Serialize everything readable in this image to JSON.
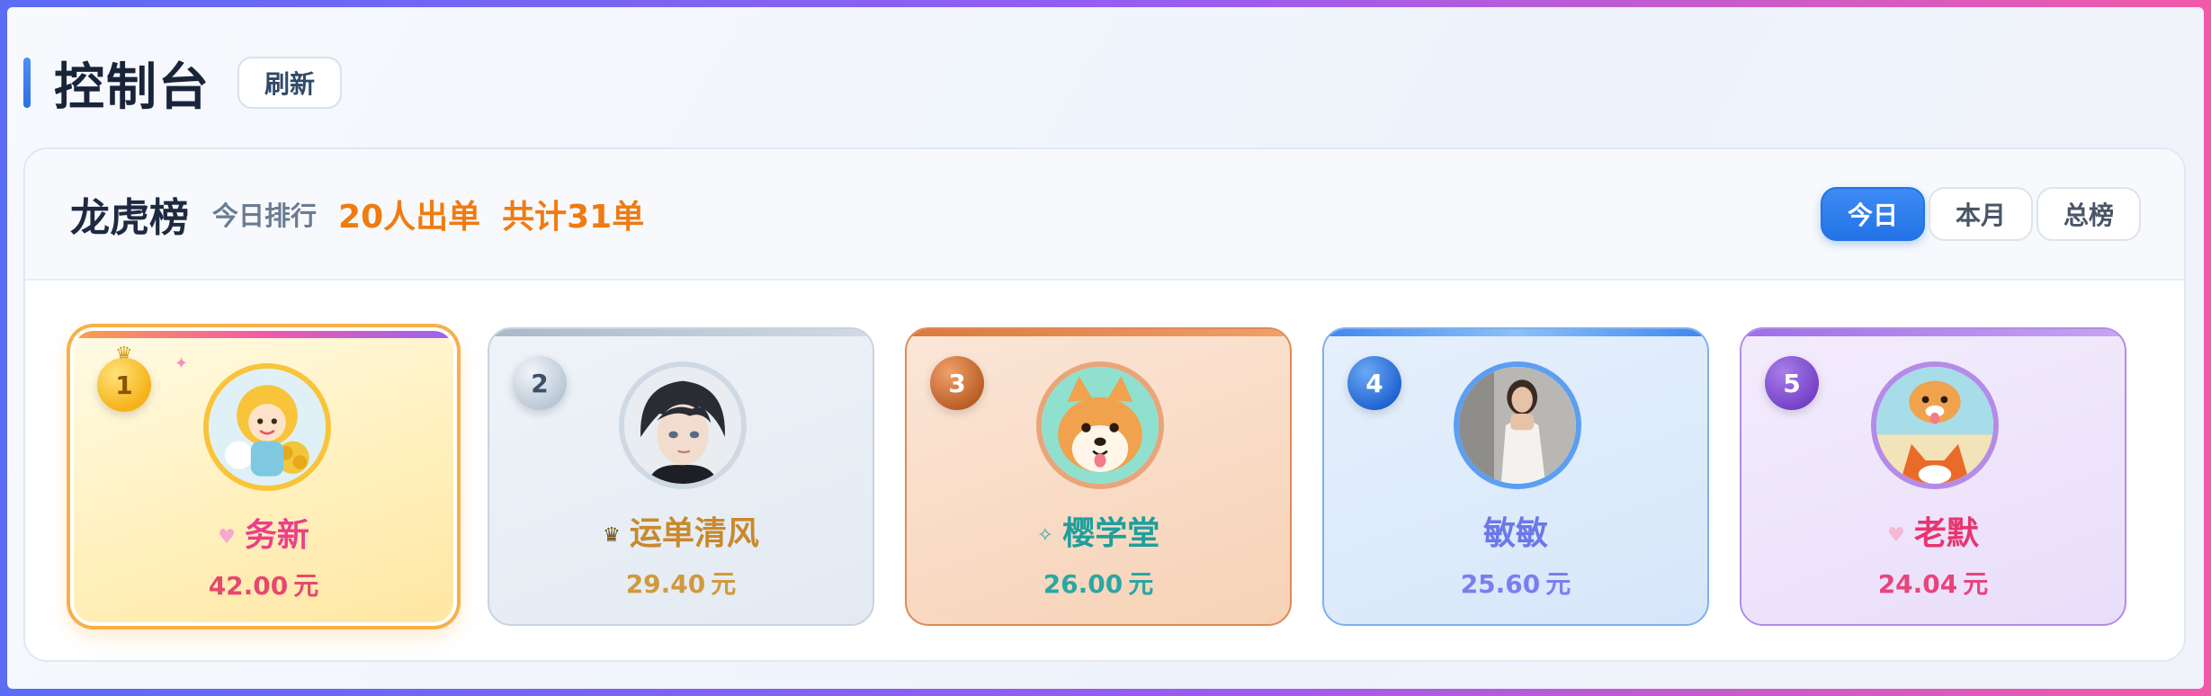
{
  "header": {
    "title": "控制台",
    "refresh_label": "刷新"
  },
  "board": {
    "title": "龙虎榜",
    "subtitle": "今日排行",
    "people_stat": "20人出单",
    "total_stat": "共计31单",
    "tabs": [
      {
        "label": "今日",
        "active": true
      },
      {
        "label": "本月",
        "active": false
      },
      {
        "label": "总榜",
        "active": false
      }
    ],
    "entries": [
      {
        "rank": "1",
        "name": "务新",
        "amount": "42.00",
        "unit": "元",
        "badge_icon": "crown-icon",
        "avatar_icon": "anime-girl-avatar"
      },
      {
        "rank": "2",
        "name": "运单清风",
        "amount": "29.40",
        "unit": "元",
        "badge_icon": "crown-icon",
        "avatar_icon": "anime-boy-avatar"
      },
      {
        "rank": "3",
        "name": "樱学堂",
        "amount": "26.00",
        "unit": "元",
        "badge_icon": "sparkle-icon",
        "avatar_icon": "shiba-dog-avatar"
      },
      {
        "rank": "4",
        "name": "敏敏",
        "amount": "25.60",
        "unit": "元",
        "badge_icon": "",
        "avatar_icon": "woman-photo-avatar"
      },
      {
        "rank": "5",
        "name": "老默",
        "amount": "24.04",
        "unit": "元",
        "badge_icon": "",
        "avatar_icon": "fox-avatar"
      }
    ]
  },
  "colors": {
    "accent": "#2473e6",
    "stat_orange": "#f07b10",
    "gold": "#f5b318",
    "silver": "#b8c6d5",
    "bronze": "#b85c24",
    "blue": "#1f62d1",
    "purple": "#7440c6"
  }
}
